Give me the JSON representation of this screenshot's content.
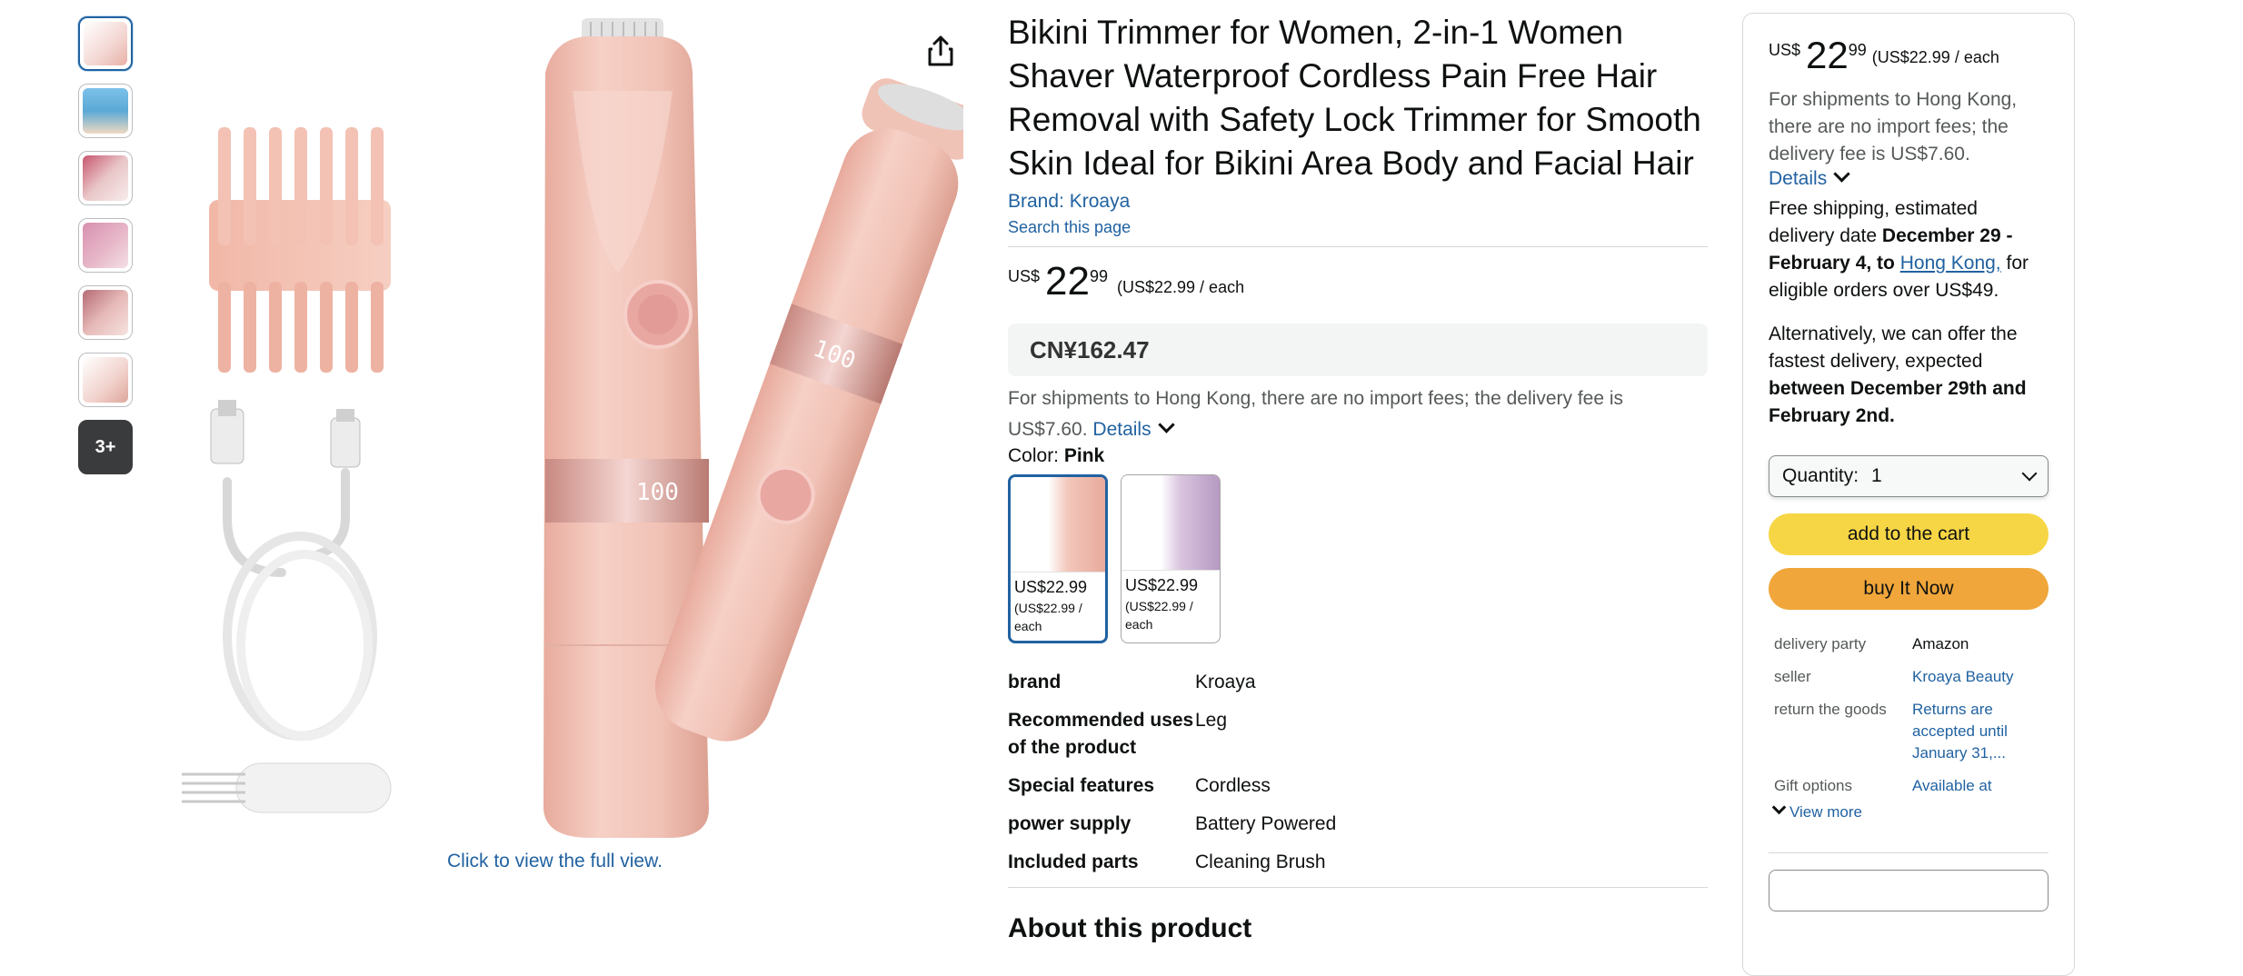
{
  "thumbnails": {
    "items": [
      {
        "name": "thumb-1",
        "color": "#f3d6d2"
      },
      {
        "name": "thumb-2",
        "color": "#5ba9d6"
      },
      {
        "name": "thumb-3",
        "color": "#e9c6c8"
      },
      {
        "name": "thumb-4",
        "color": "#e7b7c8"
      },
      {
        "name": "thumb-5",
        "color": "#e6b9b7"
      },
      {
        "name": "thumb-6",
        "color": "#f1d1cb"
      }
    ],
    "more_label": "3+"
  },
  "main_image": {
    "full_view_label": "Click to view the full view.",
    "product_color": "#f2c4b9"
  },
  "product": {
    "title": "Bikini Trimmer for Women, 2-in-1 Women Shaver Waterproof Cordless Pain Free Hair Removal with Safety Lock Trimmer for Smooth Skin Ideal for Bikini Area Body and Facial Hair",
    "brand_link": "Brand: Kroaya",
    "search_page": "Search this page",
    "price": {
      "symbol": "US$",
      "whole": "22",
      "fraction": "99",
      "unit": "(US$22.99 / each"
    },
    "cny_price": "CN¥162.47",
    "shipping_note": "For shipments to Hong Kong, there are no import fees; the delivery fee is US$7.60.",
    "details_label": "Details",
    "color_label": "Color:",
    "color_value": "Pink",
    "swatches": [
      {
        "price": "US$22.99",
        "unit": "(US$22.99 / each",
        "selected": true
      },
      {
        "price": "US$22.99",
        "unit": "(US$22.99 / each",
        "selected": false
      }
    ],
    "specs": [
      {
        "key": "brand",
        "value": "Kroaya"
      },
      {
        "key": "Recommended uses of the product",
        "value": "Leg"
      },
      {
        "key": "Special features",
        "value": "Cordless"
      },
      {
        "key": "power supply",
        "value": "Battery Powered"
      },
      {
        "key": "Included parts",
        "value": "Cleaning Brush"
      }
    ],
    "about_heading": "About this product"
  },
  "buybox": {
    "price": {
      "symbol": "US$",
      "whole": "22",
      "fraction": "99",
      "unit": "(US$22.99 / each"
    },
    "shipping_note": "For shipments to Hong Kong, there are no import fees; the delivery fee is US$7.60.",
    "details_label": "Details",
    "free_shipping_prefix": "Free shipping, estimated delivery date",
    "free_shipping_dates": "December 29 - February 4, to",
    "free_shipping_link": "Hong Kong,",
    "free_shipping_suffix": "for eligible orders over US$49.",
    "alt_prefix": "Alternatively, we can offer the fastest delivery, expected",
    "alt_dates": "between December 29th and February 2nd.",
    "quantity_label": "Quantity:",
    "quantity_value": "1",
    "add_to_cart": "add to the cart",
    "buy_now": "buy It Now",
    "info": [
      {
        "key": "delivery party",
        "value": "Amazon",
        "link": false
      },
      {
        "key": "seller",
        "value": "Kroaya Beauty",
        "link": true
      },
      {
        "key": "return the goods",
        "value": "Returns are accepted until January 31,...",
        "link": true
      },
      {
        "key": "Gift options",
        "value": "Available at",
        "link": true
      }
    ],
    "view_more": "View more",
    "colors": {
      "cart": "#f7d645",
      "buy": "#f0a63a"
    }
  }
}
